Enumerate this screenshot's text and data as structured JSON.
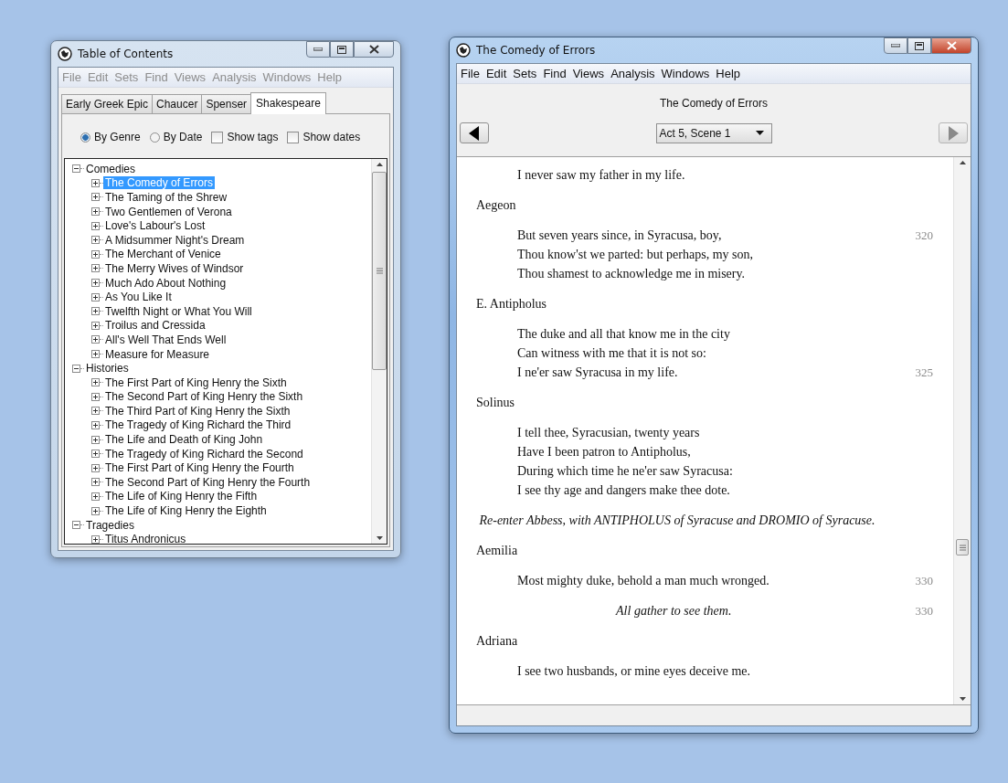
{
  "windows": [
    {
      "title": "Table of Contents",
      "active": false,
      "menu": [
        "File",
        "Edit",
        "Sets",
        "Find",
        "Views",
        "Analysis",
        "Windows",
        "Help"
      ],
      "tabs": [
        {
          "label": "Early Greek Epic",
          "selected": false
        },
        {
          "label": "Chaucer",
          "selected": false
        },
        {
          "label": "Spenser",
          "selected": false
        },
        {
          "label": "Shakespeare",
          "selected": true
        }
      ],
      "options": [
        {
          "kind": "radio",
          "label": "By Genre",
          "checked": true
        },
        {
          "kind": "radio",
          "label": "By Date",
          "checked": false
        },
        {
          "kind": "checkbox",
          "label": "Show tags",
          "checked": false
        },
        {
          "kind": "checkbox",
          "label": "Show dates",
          "checked": false
        }
      ],
      "tree": [
        {
          "label": "Comedies",
          "expanded": true,
          "selected": false,
          "children": [
            {
              "label": "The Comedy of Errors",
              "expanded": false,
              "selected": true
            },
            {
              "label": "The Taming of the Shrew",
              "expanded": false,
              "selected": false
            },
            {
              "label": "Two Gentlemen of Verona",
              "expanded": false,
              "selected": false
            },
            {
              "label": "Love's Labour's Lost",
              "expanded": false,
              "selected": false
            },
            {
              "label": "A Midsummer Night's Dream",
              "expanded": false,
              "selected": false
            },
            {
              "label": "The Merchant of Venice",
              "expanded": false,
              "selected": false
            },
            {
              "label": "The Merry Wives of Windsor",
              "expanded": false,
              "selected": false
            },
            {
              "label": "Much Ado About Nothing",
              "expanded": false,
              "selected": false
            },
            {
              "label": "As You Like It",
              "expanded": false,
              "selected": false
            },
            {
              "label": "Twelfth Night or What You Will",
              "expanded": false,
              "selected": false
            },
            {
              "label": "Troilus and Cressida",
              "expanded": false,
              "selected": false
            },
            {
              "label": "All's Well That Ends Well",
              "expanded": false,
              "selected": false
            },
            {
              "label": "Measure for Measure",
              "expanded": false,
              "selected": false
            }
          ]
        },
        {
          "label": "Histories",
          "expanded": true,
          "selected": false,
          "children": [
            {
              "label": "The First Part of King Henry the Sixth",
              "expanded": false,
              "selected": false
            },
            {
              "label": "The Second Part of King Henry the Sixth",
              "expanded": false,
              "selected": false
            },
            {
              "label": "The Third Part of King Henry the Sixth",
              "expanded": false,
              "selected": false
            },
            {
              "label": "The Tragedy of King Richard the Third",
              "expanded": false,
              "selected": false
            },
            {
              "label": "The Life and Death of King John",
              "expanded": false,
              "selected": false
            },
            {
              "label": "The Tragedy of King Richard the Second",
              "expanded": false,
              "selected": false
            },
            {
              "label": "The First Part of King Henry the Fourth",
              "expanded": false,
              "selected": false
            },
            {
              "label": "The Second Part of King Henry the Fourth",
              "expanded": false,
              "selected": false
            },
            {
              "label": "The Life of King Henry the Fifth",
              "expanded": false,
              "selected": false
            },
            {
              "label": "The Life of King Henry the Eighth",
              "expanded": false,
              "selected": false
            }
          ]
        },
        {
          "label": "Tragedies",
          "expanded": true,
          "selected": false,
          "children": [
            {
              "label": "Titus Andronicus",
              "expanded": false,
              "selected": false
            }
          ]
        }
      ]
    },
    {
      "title": "The Comedy of Errors",
      "active": true,
      "menu": [
        "File",
        "Edit",
        "Sets",
        "Find",
        "Views",
        "Analysis",
        "Windows",
        "Help"
      ],
      "heading": "The Comedy of Errors",
      "scene": "Act 5, Scene 1",
      "prev_enabled": true,
      "next_enabled": false,
      "blocks": [
        {
          "kind": "verse",
          "lines": [
            {
              "text": "I never saw my father in my life."
            }
          ]
        },
        {
          "kind": "speaker",
          "text": "Aegeon"
        },
        {
          "kind": "verse",
          "lines": [
            {
              "text": "But seven years since, in Syracusa, boy,",
              "number": "320"
            },
            {
              "text": "Thou know'st we parted: but perhaps, my son,"
            },
            {
              "text": "Thou shamest to acknowledge me in misery."
            }
          ]
        },
        {
          "kind": "speaker",
          "text": "E. Antipholus"
        },
        {
          "kind": "verse",
          "lines": [
            {
              "text": "The duke and all that know me in the city"
            },
            {
              "text": "Can witness with me that it is not so:"
            },
            {
              "text": "I ne'er saw Syracusa in my life.",
              "number": "325"
            }
          ]
        },
        {
          "kind": "speaker",
          "text": "Solinus"
        },
        {
          "kind": "verse",
          "lines": [
            {
              "text": "I tell thee, Syracusian, twenty years"
            },
            {
              "text": "Have I been patron to Antipholus,"
            },
            {
              "text": "During which time he ne'er saw Syracusa:"
            },
            {
              "text": "I see thy age and dangers make thee dote."
            }
          ]
        },
        {
          "kind": "direction",
          "text": "Re-enter Abbess, with ANTIPHOLUS of Syracuse and DROMIO of Syracuse."
        },
        {
          "kind": "speaker",
          "text": "Aemilia"
        },
        {
          "kind": "verse",
          "lines": [
            {
              "text": "Most mighty duke, behold a man much wronged.",
              "number": "330"
            }
          ]
        },
        {
          "kind": "direction",
          "text": "All gather to see them.",
          "number": "330"
        },
        {
          "kind": "speaker",
          "text": "Adriana"
        },
        {
          "kind": "verse",
          "lines": [
            {
              "text": "I see two husbands, or mine eyes deceive me."
            }
          ]
        }
      ]
    }
  ]
}
